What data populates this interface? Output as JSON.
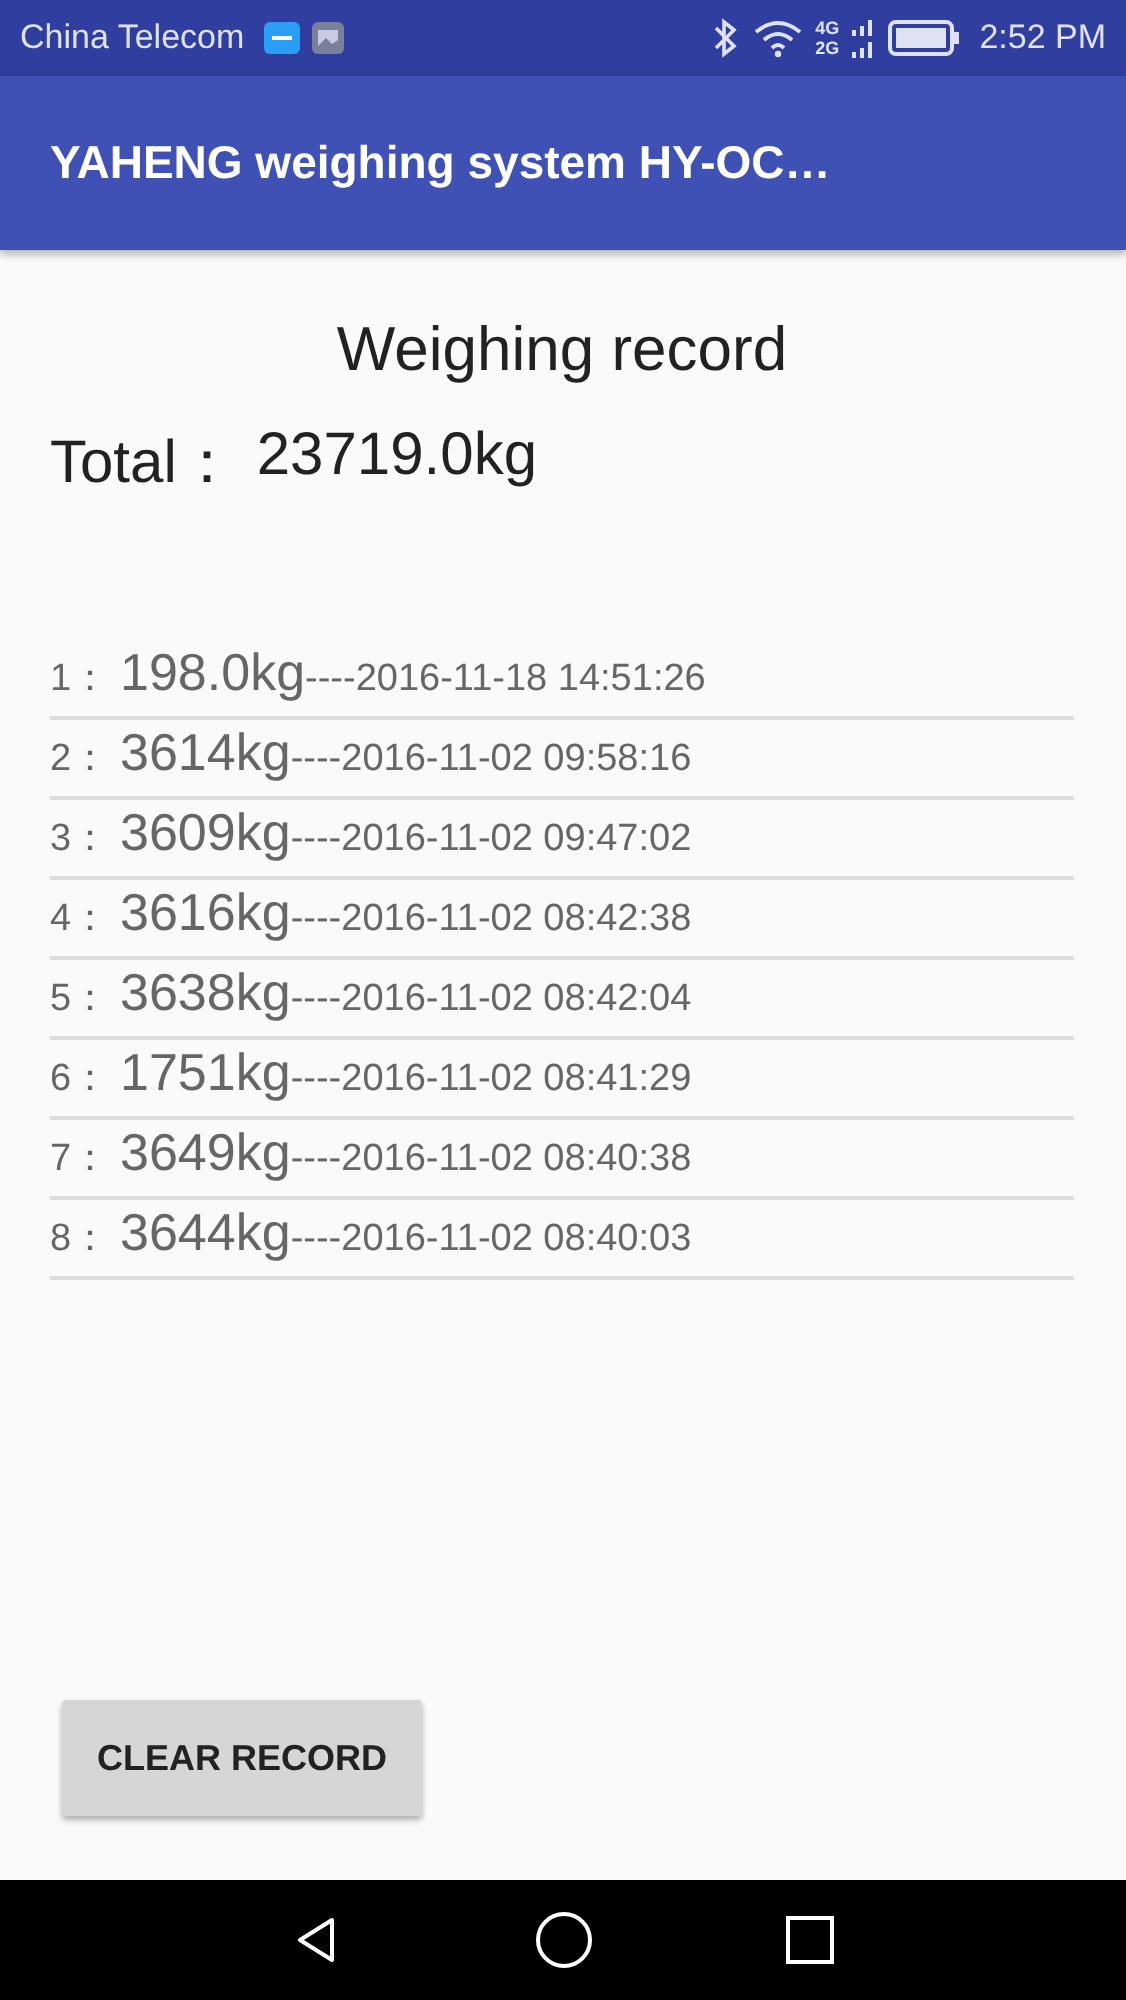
{
  "status_bar": {
    "carrier": "China Telecom",
    "network_top": "4G",
    "network_bottom": "2G",
    "time": "2:52 PM"
  },
  "app_bar": {
    "title": "YAHENG weighing system HY-OC…"
  },
  "heading": "Weighing record",
  "total": {
    "label": "Total：",
    "value": "23719.0kg"
  },
  "records": [
    {
      "index": "1：",
      "weight": "198.0kg",
      "time": "----2016-11-18 14:51:26"
    },
    {
      "index": "2：",
      "weight": "3614kg",
      "time": "----2016-11-02 09:58:16"
    },
    {
      "index": "3：",
      "weight": "3609kg",
      "time": "----2016-11-02 09:47:02"
    },
    {
      "index": "4：",
      "weight": "3616kg",
      "time": "----2016-11-02 08:42:38"
    },
    {
      "index": "5：",
      "weight": "3638kg",
      "time": "----2016-11-02 08:42:04"
    },
    {
      "index": "6：",
      "weight": "1751kg",
      "time": "----2016-11-02 08:41:29"
    },
    {
      "index": "7：",
      "weight": "3649kg",
      "time": "----2016-11-02 08:40:38"
    },
    {
      "index": "8：",
      "weight": "3644kg",
      "time": "----2016-11-02 08:40:03"
    }
  ],
  "clear_button": "CLEAR RECORD"
}
